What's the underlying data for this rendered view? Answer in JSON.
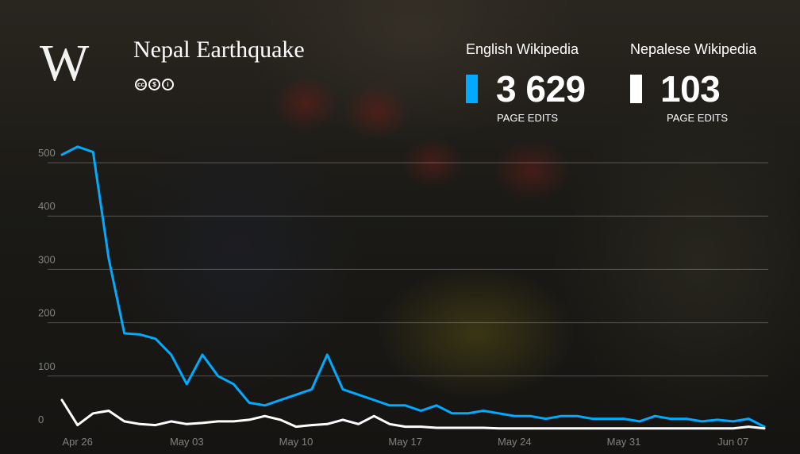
{
  "header": {
    "logo_text": "W",
    "title": "Nepal Earthquake",
    "license_icons": [
      "cc-icon",
      "nc-icon",
      "by-icon"
    ]
  },
  "stats": [
    {
      "name": "English Wikipedia",
      "value": "3 629",
      "caption": "PAGE EDITS",
      "color": "#00aaff"
    },
    {
      "name": "Nepalese Wikipedia",
      "value": "103",
      "caption": "PAGE EDITS",
      "color": "#ffffff"
    }
  ],
  "chart_data": {
    "type": "line",
    "title": "",
    "xlabel": "",
    "ylabel": "",
    "x_ticks": [
      "Apr 26",
      "May 03",
      "May 10",
      "May 17",
      "May 24",
      "May 31",
      "Jun 07"
    ],
    "y_ticks": [
      0,
      100,
      200,
      300,
      400,
      500
    ],
    "ylim": [
      0,
      520
    ],
    "grid": true,
    "x": [
      "Apr 25",
      "Apr 26",
      "Apr 27",
      "Apr 28",
      "Apr 29",
      "Apr 30",
      "May 01",
      "May 02",
      "May 03",
      "May 04",
      "May 05",
      "May 06",
      "May 07",
      "May 08",
      "May 09",
      "May 10",
      "May 11",
      "May 12",
      "May 13",
      "May 14",
      "May 15",
      "May 16",
      "May 17",
      "May 18",
      "May 19",
      "May 20",
      "May 21",
      "May 22",
      "May 23",
      "May 24",
      "May 25",
      "May 26",
      "May 27",
      "May 28",
      "May 29",
      "May 30",
      "May 31",
      "Jun 01",
      "Jun 02",
      "Jun 03",
      "Jun 04",
      "Jun 05",
      "Jun 06",
      "Jun 07",
      "Jun 08",
      "Jun 09"
    ],
    "series": [
      {
        "color": "#00aaff",
        "values": [
          515,
          530,
          520,
          320,
          180,
          178,
          170,
          140,
          85,
          140,
          100,
          85,
          50,
          45,
          55,
          65,
          75,
          140,
          75,
          65,
          55,
          45,
          45,
          35,
          45,
          30,
          30,
          35,
          30,
          25,
          25,
          20,
          25,
          25,
          20,
          20,
          20,
          15,
          25,
          20,
          20,
          15,
          18,
          15,
          20,
          5
        ]
      },
      {
        "color": "#ffffff",
        "values": [
          55,
          8,
          30,
          35,
          15,
          10,
          8,
          15,
          10,
          12,
          15,
          15,
          18,
          25,
          18,
          5,
          8,
          10,
          18,
          10,
          25,
          10,
          5,
          5,
          3,
          3,
          3,
          3,
          2,
          2,
          2,
          2,
          2,
          2,
          2,
          2,
          2,
          2,
          2,
          2,
          2,
          2,
          2,
          2,
          5,
          2
        ]
      }
    ]
  }
}
